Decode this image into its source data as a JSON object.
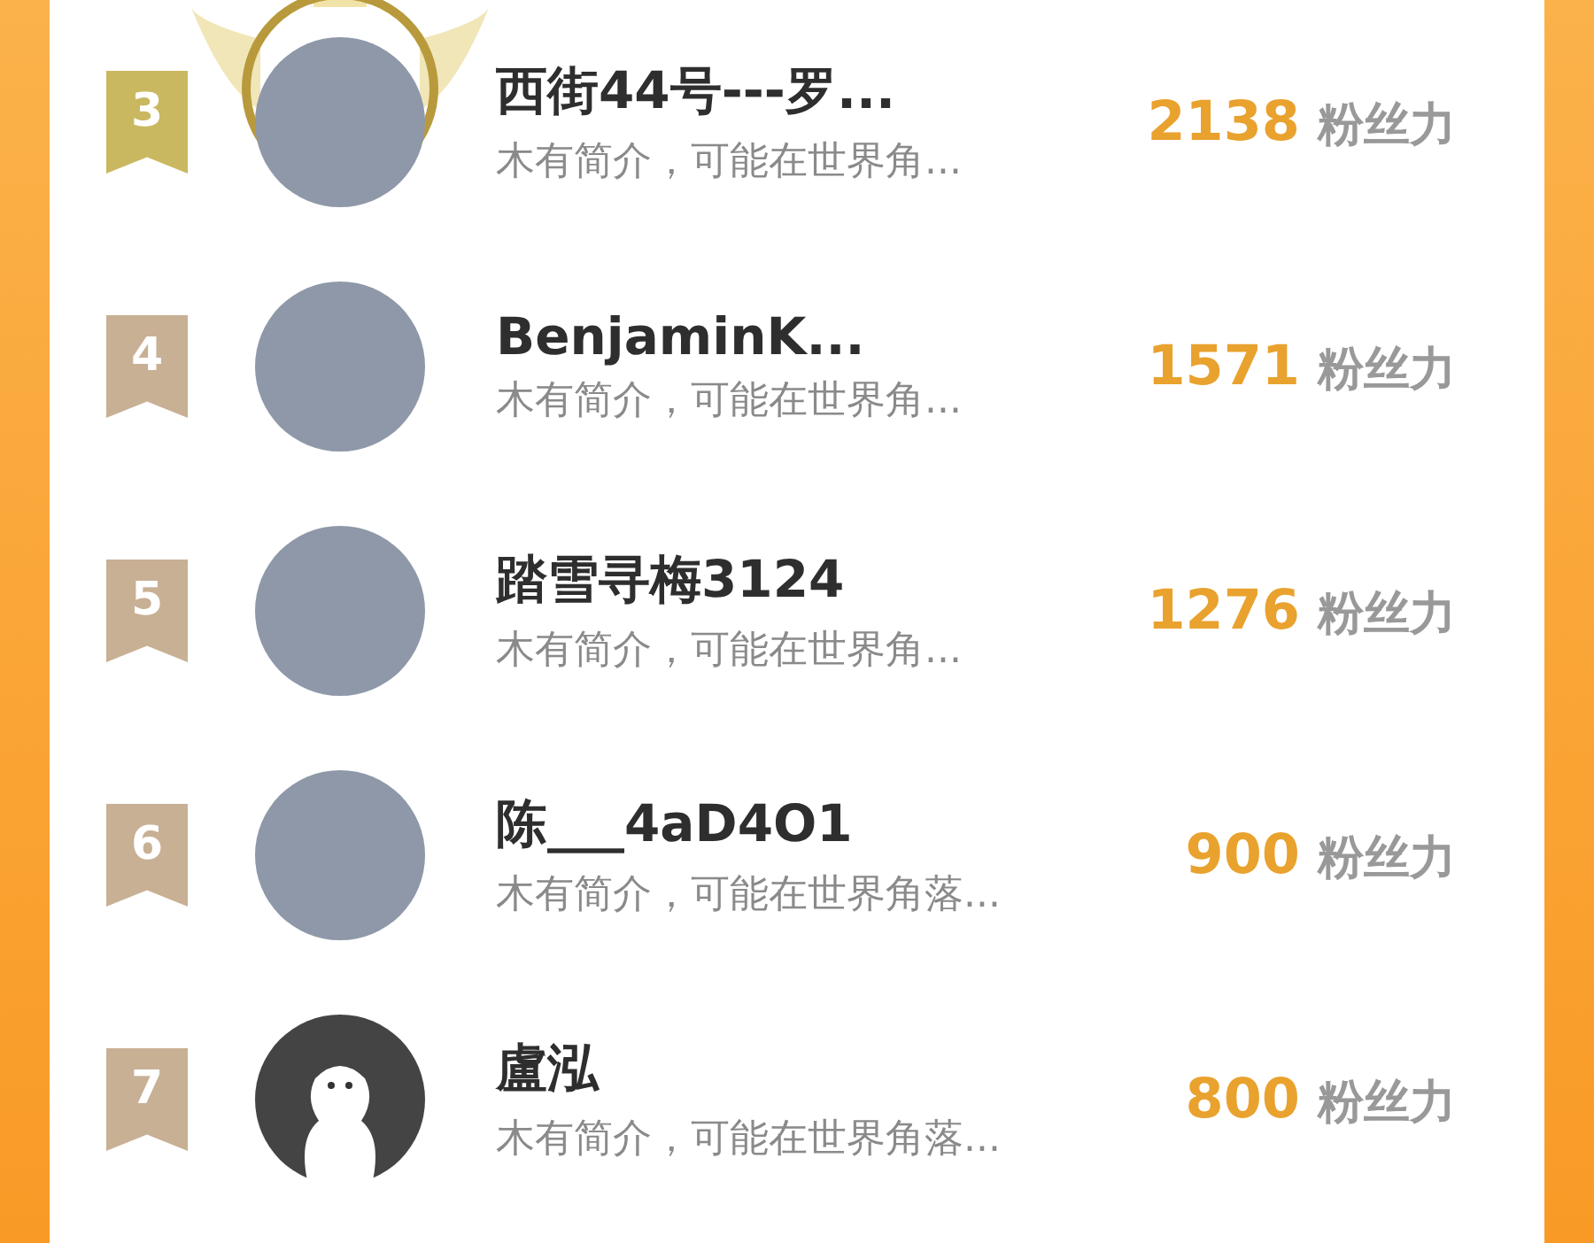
{
  "ranking": [
    {
      "rank": "3",
      "color": "#c9b860",
      "crowned": true,
      "kind": "photo",
      "name": "西街44号---罗...",
      "bio": "木有简介，可能在世界角...",
      "score": "2138",
      "score_unit": "粉丝力"
    },
    {
      "rank": "4",
      "color": "#c8b095",
      "crowned": false,
      "kind": "photo",
      "name": "BenjaminK...",
      "bio": "木有简介，可能在世界角...",
      "score": "1571",
      "score_unit": "粉丝力"
    },
    {
      "rank": "5",
      "color": "#c8b095",
      "crowned": false,
      "kind": "photo",
      "name": "踏雪寻梅3124",
      "bio": "木有简介，可能在世界角...",
      "score": "1276",
      "score_unit": "粉丝力"
    },
    {
      "rank": "6",
      "color": "#c8b095",
      "crowned": false,
      "kind": "photo",
      "name": "陈___4aD4O1",
      "bio": "木有简介，可能在世界角落...",
      "score": "900",
      "score_unit": "粉丝力"
    },
    {
      "rank": "7",
      "color": "#c8b095",
      "crowned": false,
      "kind": "default",
      "name": "盧泓",
      "bio": "木有简介，可能在世界角落...",
      "score": "800",
      "score_unit": "粉丝力"
    }
  ]
}
